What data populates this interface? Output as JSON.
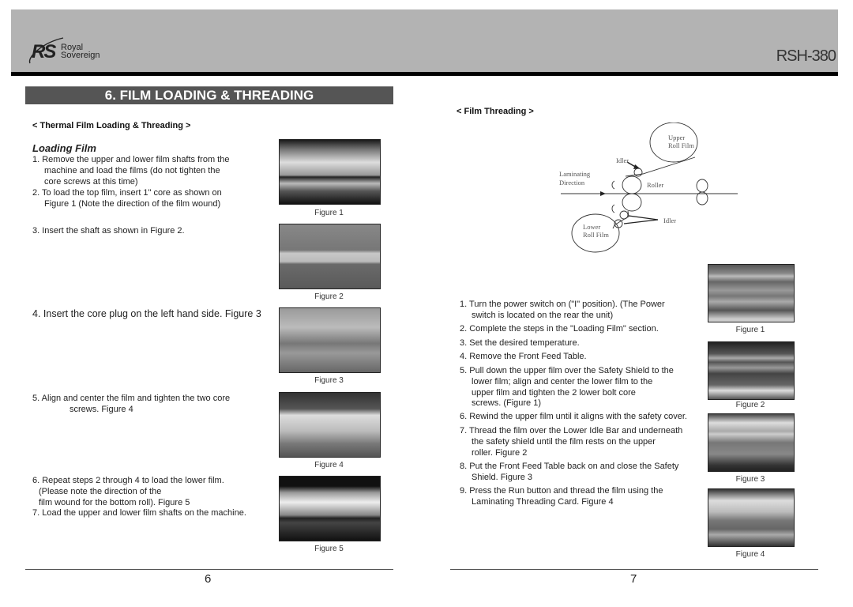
{
  "header": {
    "brand_initials": "RS",
    "brand_line1": "Royal",
    "brand_line2": "Sovereign",
    "model": "RSH-380"
  },
  "section_title": "6.  FILM LOADING & THREADING",
  "left_page": {
    "subheading": "< Thermal Film Loading & Threading >",
    "title": "Loading Film",
    "steps": [
      {
        "first": "1. Remove the upper and lower film shafts from the",
        "rest": [
          "machine and load the films (do not tighten the",
          "core screws at this time)"
        ]
      },
      {
        "first": "2. To load the top film, insert 1\" core as shown on",
        "rest": [
          "Figure 1 (Note the direction of the film wound)"
        ]
      },
      {
        "first": "3. Insert the shaft as shown in Figure 2.",
        "rest": []
      },
      {
        "first": "4. Insert the core plug on the left hand side.  Figure 3",
        "rest": []
      },
      {
        "first": "5. Align and center the film and tighten the two core",
        "rest": [
          "screws. Figure 4"
        ]
      },
      {
        "first": "6. Repeat steps 2 through 4 to load the lower film.",
        "rest": [
          "(Please note the direction of the",
          "film wound for the bottom roll).  Figure 5"
        ]
      },
      {
        "first": "7. Load the upper and lower film shafts on the machine.",
        "rest": []
      }
    ],
    "figures": [
      "Figure 1",
      "Figure 2",
      "Figure 3",
      "Figure 4",
      "Figure 5"
    ],
    "page_number": "6"
  },
  "right_page": {
    "subheading": "< Film Threading >",
    "diagram": {
      "upper_roll": [
        "Upper",
        "Roll Film"
      ],
      "lower_roll": [
        "Lower",
        "Roll Film"
      ],
      "idler_top": "Idler",
      "idler_bottom": "Idler",
      "direction": [
        "Laminating",
        "Direction"
      ],
      "roller": "Roller"
    },
    "steps": [
      {
        "first": "1. Turn the power switch on (\"I\" position).  (The Power",
        "rest": [
          "switch is located on the rear the unit)"
        ]
      },
      {
        "first": "2. Complete the steps in the  \"Loading Film\" section.",
        "rest": []
      },
      {
        "first": "3. Set the desired temperature.",
        "rest": []
      },
      {
        "first": "4. Remove the Front Feed Table.",
        "rest": []
      },
      {
        "first": "5. Pull down the upper film over the Safety Shield to the",
        "rest": [
          "lower film; align and center the lower film to the",
          "upper film and tighten the 2 lower bolt core",
          "screws. (Figure 1)"
        ]
      },
      {
        "first": "6. Rewind the upper film until it aligns with the safety cover.",
        "rest": []
      },
      {
        "first": "7. Thread the film over the Lower Idle Bar and underneath",
        "rest": [
          "the safety shield until the film rests on the upper",
          "roller. Figure 2"
        ]
      },
      {
        "first": "8. Put the Front Feed Table back on and close the Safety",
        "rest": [
          "Shield.  Figure 3"
        ]
      },
      {
        "first": "9. Press the Run button and thread the film using the",
        "rest": [
          "Laminating Threading Card.  Figure 4"
        ]
      }
    ],
    "figures": [
      "Figure 1",
      "Figure 2",
      "Figure 3",
      "Figure 4"
    ],
    "page_number": "7"
  }
}
